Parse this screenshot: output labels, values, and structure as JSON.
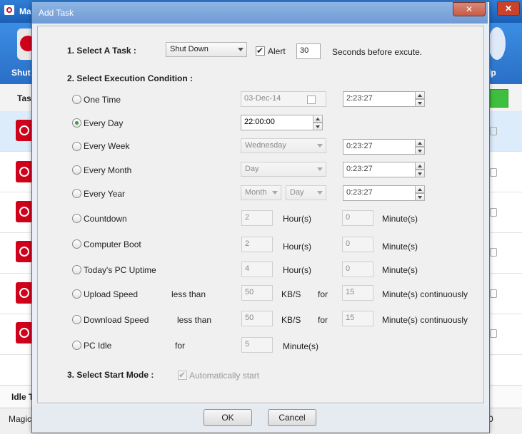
{
  "main_window": {
    "title": "Ma",
    "close_glyph": "✕",
    "toolbar": {
      "shutdown_label": "Shut",
      "help_label": "lp"
    },
    "list_header": "Tas",
    "idle_label": "Idle T",
    "status_left": "Magic",
    "status_right": "0"
  },
  "dialog": {
    "title": "Add Task",
    "close_glyph": "✕",
    "section1": {
      "label": "1. Select A Task :",
      "task_value": "Shut Down",
      "alert_label": "Alert",
      "alert_checked": true,
      "alert_seconds": "30",
      "seconds_label": "Seconds before excute."
    },
    "section2": {
      "label": "2. Select Execution Condition :",
      "one_time": {
        "label": "One Time",
        "date": "03-Dec-14",
        "time": "2:23:27"
      },
      "every_day": {
        "label": "Every Day",
        "time": "22:00:00",
        "selected": true
      },
      "every_week": {
        "label": "Every Week",
        "day": "Wednesday",
        "time": "0:23:27"
      },
      "every_month": {
        "label": "Every Month",
        "day": "Day",
        "time": "0:23:27"
      },
      "every_year": {
        "label": "Every Year",
        "month": "Month",
        "day": "Day",
        "time": "0:23:27"
      },
      "countdown": {
        "label": "Countdown",
        "hours": "2",
        "hours_unit": "Hour(s)",
        "minutes": "0",
        "minutes_unit": "Minute(s)"
      },
      "computer_boot": {
        "label": "Computer Boot",
        "hours": "2",
        "hours_unit": "Hour(s)",
        "minutes": "0",
        "minutes_unit": "Minute(s)"
      },
      "pc_uptime": {
        "label": "Today's PC Uptime",
        "hours": "4",
        "hours_unit": "Hour(s)",
        "minutes": "0",
        "minutes_unit": "Minute(s)"
      },
      "upload_speed": {
        "label": "Upload Speed",
        "comparator": "less than",
        "value": "50",
        "unit": "KB/S",
        "for_label": "for",
        "minutes": "15",
        "minutes_unit": "Minute(s)  continuously"
      },
      "download_speed": {
        "label": "Download Speed",
        "comparator": "less than",
        "value": "50",
        "unit": "KB/S",
        "for_label": "for",
        "minutes": "15",
        "minutes_unit": "Minute(s) continuously"
      },
      "pc_idle": {
        "label": "PC Idle",
        "for_label": "for",
        "minutes": "5",
        "minutes_unit": "Minute(s)"
      }
    },
    "section3": {
      "label": "3. Select Start Mode :",
      "auto_start_label": "Automatically start",
      "auto_start_checked": true
    },
    "ok_label": "OK",
    "cancel_label": "Cancel"
  }
}
